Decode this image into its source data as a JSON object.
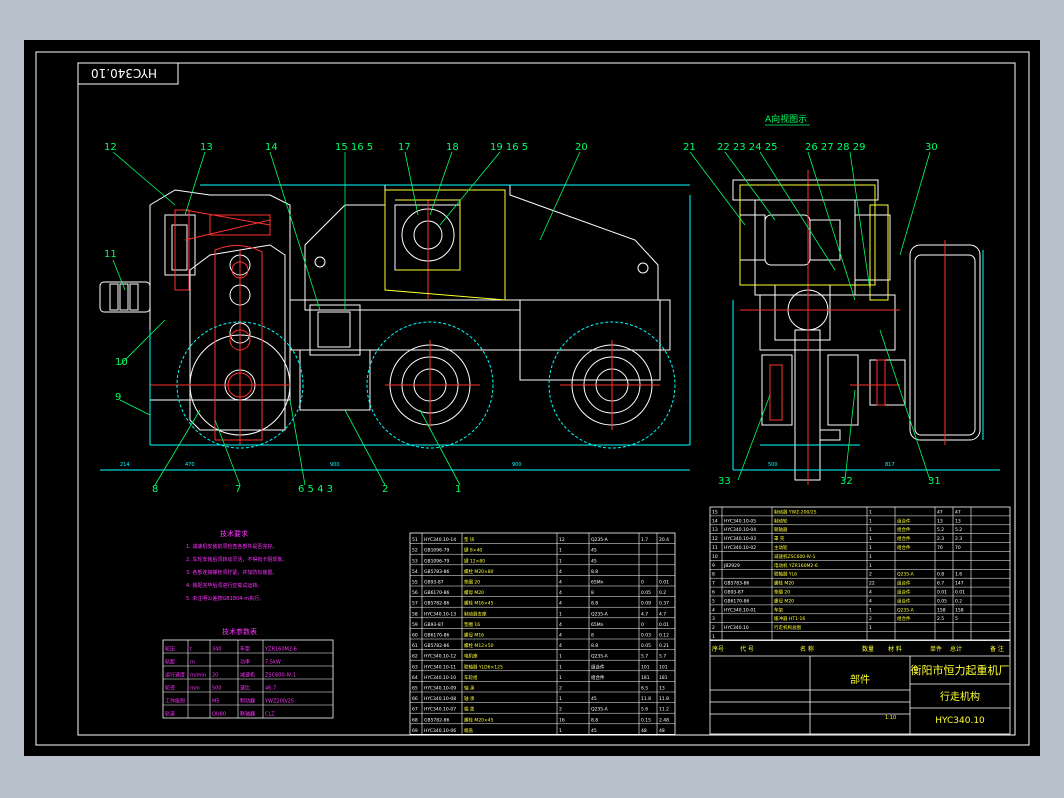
{
  "drawing": {
    "code_box": "HYC340.10",
    "view_note": "A向视图示",
    "balloons_left": [
      "12",
      "13",
      "14",
      "15 16 5",
      "17",
      "18",
      "19 16 5",
      "20",
      "11",
      "10",
      "9",
      "8",
      "7",
      "6 5 4 3",
      "2",
      "1"
    ],
    "balloons_right": [
      "21",
      "22 23 24 25",
      "26 27 28 29",
      "30",
      "33",
      "32",
      "31"
    ],
    "dims_left": [
      "214",
      "470",
      "900",
      "900"
    ],
    "dims_right": [
      "500",
      "817"
    ]
  },
  "tech_notes": {
    "title": "技术要求",
    "lines": [
      "1. 减速机安装前须检查各部件是否完好。",
      "2. 车轮安装后须转动灵活，不得有卡阻现象。",
      "3. 各部连接螺栓须拧紧，并加防松装置。",
      "4. 装配完毕后须进行空载试运转。",
      "5. 未注明公差按GB1804-m执行。"
    ]
  },
  "params_table": {
    "title": "技术参数表",
    "rows": [
      [
        "轮压",
        "t",
        "340",
        "车型",
        "YZR160M2-6"
      ],
      [
        "轨距",
        "m",
        "",
        "功率",
        "7.5kW"
      ],
      [
        "运行速度",
        "m/min",
        "20",
        "减速机",
        "ZSC600-Ⅳ-1"
      ],
      [
        "轮径",
        "mm",
        "500",
        "速比",
        "46.7"
      ],
      [
        "工作级别",
        "",
        "M5",
        "制动器",
        "YWZ200/25"
      ],
      [
        "轨道",
        "",
        "QU80",
        "联轴器",
        "CLZ"
      ]
    ]
  },
  "bom_left": [
    [
      "51",
      "HYC340.10-14",
      "垫 块",
      "12",
      "Q235-A",
      "1.7",
      "20.4"
    ],
    [
      "52",
      "GB1096-79",
      "键 8×40",
      "1",
      "45",
      "",
      ""
    ],
    [
      "53",
      "GB1096-79",
      "键 12×80",
      "1",
      "45",
      "",
      ""
    ],
    [
      "54",
      "GB5783-86",
      "螺栓 M20×80",
      "4",
      "8.8",
      "",
      ""
    ],
    [
      "55",
      "GB93-87",
      "垫圈 20",
      "4",
      "65Mn",
      "0",
      "0.01"
    ],
    [
      "56",
      "GB6170-86",
      "螺母 M20",
      "4",
      "8",
      "0.05",
      "0.2"
    ],
    [
      "57",
      "GB5782-86",
      "螺栓 M16×45",
      "4",
      "8.8",
      "0.09",
      "0.37"
    ],
    [
      "58",
      "HYC340.10-13",
      "制动器支座",
      "1",
      "Q235-A",
      "4.7",
      "4.7"
    ],
    [
      "59",
      "GB93-87",
      "垫圈 16",
      "4",
      "65Mn",
      "0",
      "0.01"
    ],
    [
      "60",
      "GB6170-86",
      "螺母 M16",
      "4",
      "8",
      "0.03",
      "0.12"
    ],
    [
      "61",
      "GB5782-86",
      "螺栓 M12×50",
      "4",
      "8.8",
      "0.05",
      "0.21"
    ],
    [
      "62",
      "HYC340.10-12",
      "电机座",
      "1",
      "Q235-A",
      "5.7",
      "5.7"
    ],
    [
      "63",
      "HYC340.10-11",
      "联轴器 YLD6×125",
      "1",
      "组合件",
      "101",
      "101"
    ],
    [
      "64",
      "HYC340.10-10",
      "车轮组",
      "1",
      "组合件",
      "181",
      "181"
    ],
    [
      "65",
      "HYC340.10-09",
      "轴 承",
      "2",
      "",
      "6.5",
      "13"
    ],
    [
      "66",
      "HYC340.10-08",
      "轴 承",
      "1",
      "45",
      "11.8",
      "11.8"
    ],
    [
      "67",
      "HYC340.10-07",
      "端 盖",
      "2",
      "Q235-A",
      "5.6",
      "11.2"
    ],
    [
      "68",
      "GB5782-86",
      "螺栓 M20×45",
      "16",
      "8.8",
      "0.15",
      "2.48"
    ],
    [
      "69",
      "HYC340.10-06",
      "端盖",
      "1",
      "45",
      "48",
      "48"
    ]
  ],
  "bom_right": [
    [
      "15",
      "",
      "制动器 YWZ-200/25",
      "1",
      "",
      "47",
      "47"
    ],
    [
      "14",
      "HYC340.10-05",
      "制动轮",
      "1",
      "组合件",
      "13",
      "13"
    ],
    [
      "13",
      "HYC340.10-04",
      "联轴器",
      "1",
      "组合件",
      "5.2",
      "5.2"
    ],
    [
      "12",
      "HYC340.10-03",
      "罩 壳",
      "1",
      "组合件",
      "2.3",
      "2.3"
    ],
    [
      "11",
      "HYC340.10-02",
      "主动轮",
      "1",
      "组合件",
      "70",
      "70"
    ],
    [
      "10",
      "",
      "减速机ZSC600-Ⅳ-1",
      "1",
      "",
      "",
      ""
    ],
    [
      "9",
      "JB2929",
      "电动机 YZR160M2-6",
      "1",
      "",
      "",
      ""
    ],
    [
      "8",
      "",
      "联轴器 YL6",
      "2",
      "Q235-A",
      "0.8",
      "1.6"
    ],
    [
      "7",
      "GB5783-86",
      "螺栓 M20",
      "22",
      "组合件",
      "6.7",
      "147"
    ],
    [
      "6",
      "GB93-87",
      "垫圈 20",
      "4",
      "组合件",
      "0.01",
      "0.01"
    ],
    [
      "5",
      "GB6170-86",
      "螺母 M20",
      "4",
      "组合件",
      "0.05",
      "0.2"
    ],
    [
      "4",
      "HYC340.10-01",
      "车架",
      "1",
      "Q235-A",
      "158",
      "158"
    ],
    [
      "3",
      "",
      "缓冲器 HT1-16",
      "2",
      "组合件",
      "2.5",
      "5"
    ],
    [
      "2",
      "HYC340.10",
      "行走机构总图",
      "1",
      "",
      "",
      ""
    ],
    [
      "1",
      "",
      "",
      "",
      "",
      "",
      ""
    ]
  ],
  "title_block": {
    "company": "衡阳市恒力起重机厂",
    "drawing_name": "行走机构",
    "drawing_no": "HYC340.10",
    "part_label": "部件",
    "headers": [
      "序号",
      "代 号",
      "名 称",
      "数量",
      "材 料",
      "单件",
      "总计",
      "备 注"
    ],
    "scale": "1:10"
  }
}
